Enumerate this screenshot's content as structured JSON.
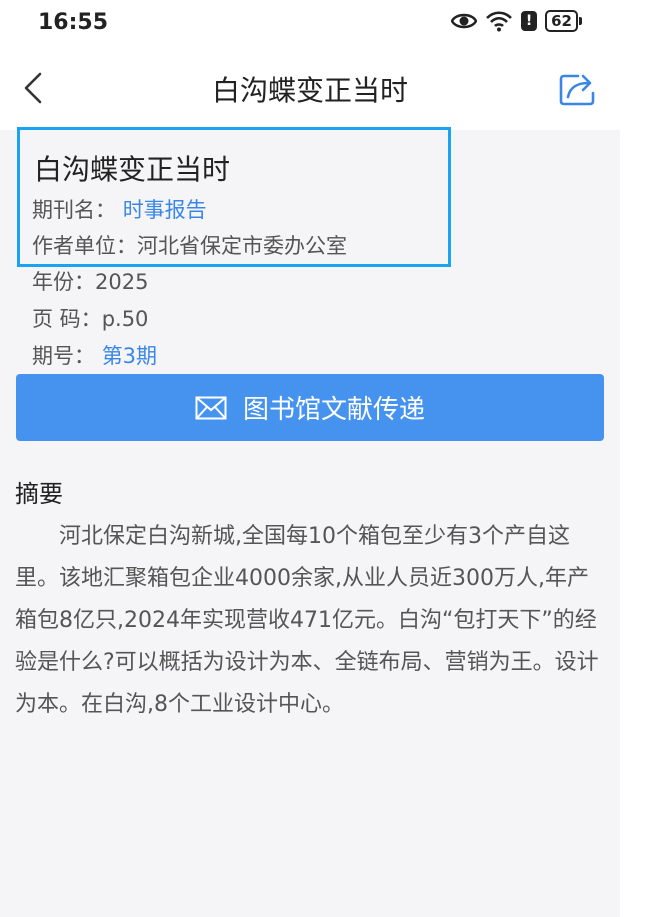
{
  "statusbar": {
    "time": "16:55",
    "battery": "62"
  },
  "header": {
    "title": "白沟蝶变正当时"
  },
  "article": {
    "title": "白沟蝶变正当时",
    "journal_label": "期刊名：",
    "journal": "时事报告",
    "author_label": "作者单位：",
    "author": "河北省保定市委办公室",
    "year_label": "年份：",
    "year": "2025",
    "page_label": "页 码：",
    "page": "p.50",
    "issue_label": "期号：",
    "issue": "第3期"
  },
  "deliver_button": {
    "label": "图书馆文献传递"
  },
  "abstract": {
    "label": "摘要",
    "text": "河北保定白沟新城,全国每10个箱包至少有3个产自这里。该地汇聚箱包企业4000余家,从业人员近300万人,年产箱包8亿只,2024年实现营收471亿元。白沟“包打天下”的经验是什么?可以概括为设计为本、全链布局、营销为王。设计为本。在白沟,8个工业设计中心。"
  },
  "colors": {
    "accent": "#4593ef",
    "link": "#3a86e8",
    "highlight": "#1aa3f0"
  },
  "icons": [
    "back-arrow-icon",
    "share-icon",
    "mail-icon",
    "eye-icon",
    "wifi-icon",
    "alert-icon",
    "battery-icon"
  ]
}
